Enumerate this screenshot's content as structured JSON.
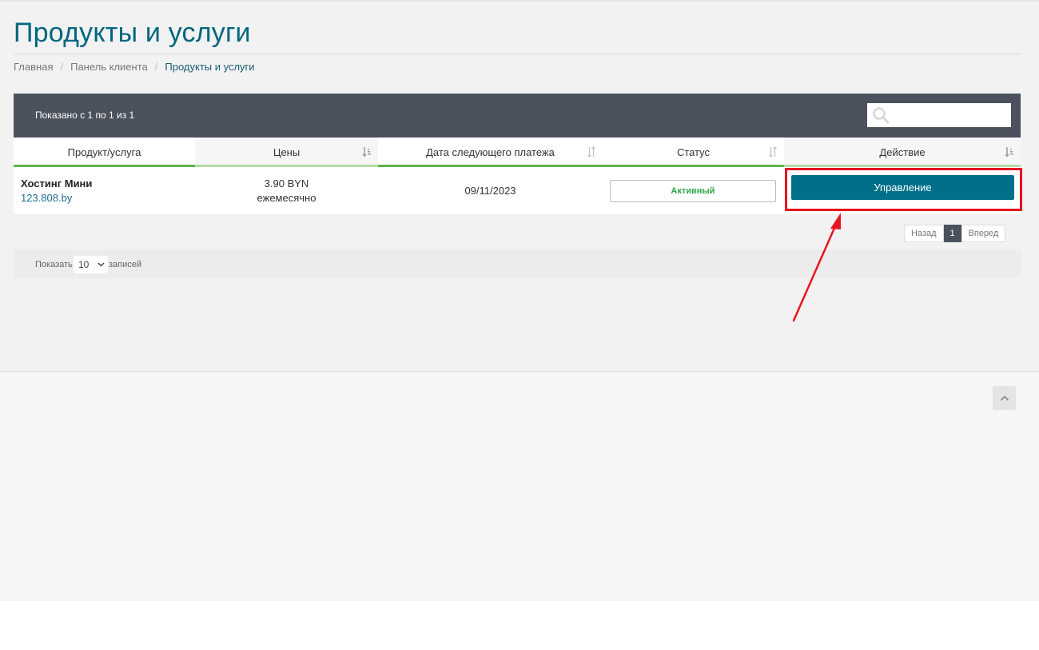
{
  "page": {
    "title": "Продукты и услуги"
  },
  "breadcrumb": [
    {
      "label": "Главная"
    },
    {
      "label": "Панель клиента"
    },
    {
      "label": "Продукты и услуги"
    }
  ],
  "table": {
    "shown_info": "Показано с 1 по 1 из 1",
    "search": {
      "placeholder": "",
      "value": ""
    },
    "columns": [
      {
        "label": "Продукт/услуга"
      },
      {
        "label": "Цены"
      },
      {
        "label": "Дата следующего платежа"
      },
      {
        "label": "Статус"
      },
      {
        "label": "Действие"
      }
    ],
    "rows": [
      {
        "product_name": "Хостинг Мини",
        "domain": "123.808.by",
        "price": "3.90 BYN",
        "billing_cycle": "ежемесячно",
        "next_due": "09/11/2023",
        "status": "Активный",
        "action_label": "Управление"
      }
    ]
  },
  "pagination": {
    "prev_label": "Назад",
    "current_page": "1",
    "next_label": "Вперед"
  },
  "length_menu": {
    "prefix": "Показать",
    "selected": "10",
    "suffix": "записей"
  },
  "colors": {
    "title": "#00667f",
    "header_bar": "#4b525d",
    "accent_green": "#5ab54b",
    "button": "#00708a",
    "status_active": "#2fa84f",
    "highlight_annotation": "#e8131f"
  }
}
